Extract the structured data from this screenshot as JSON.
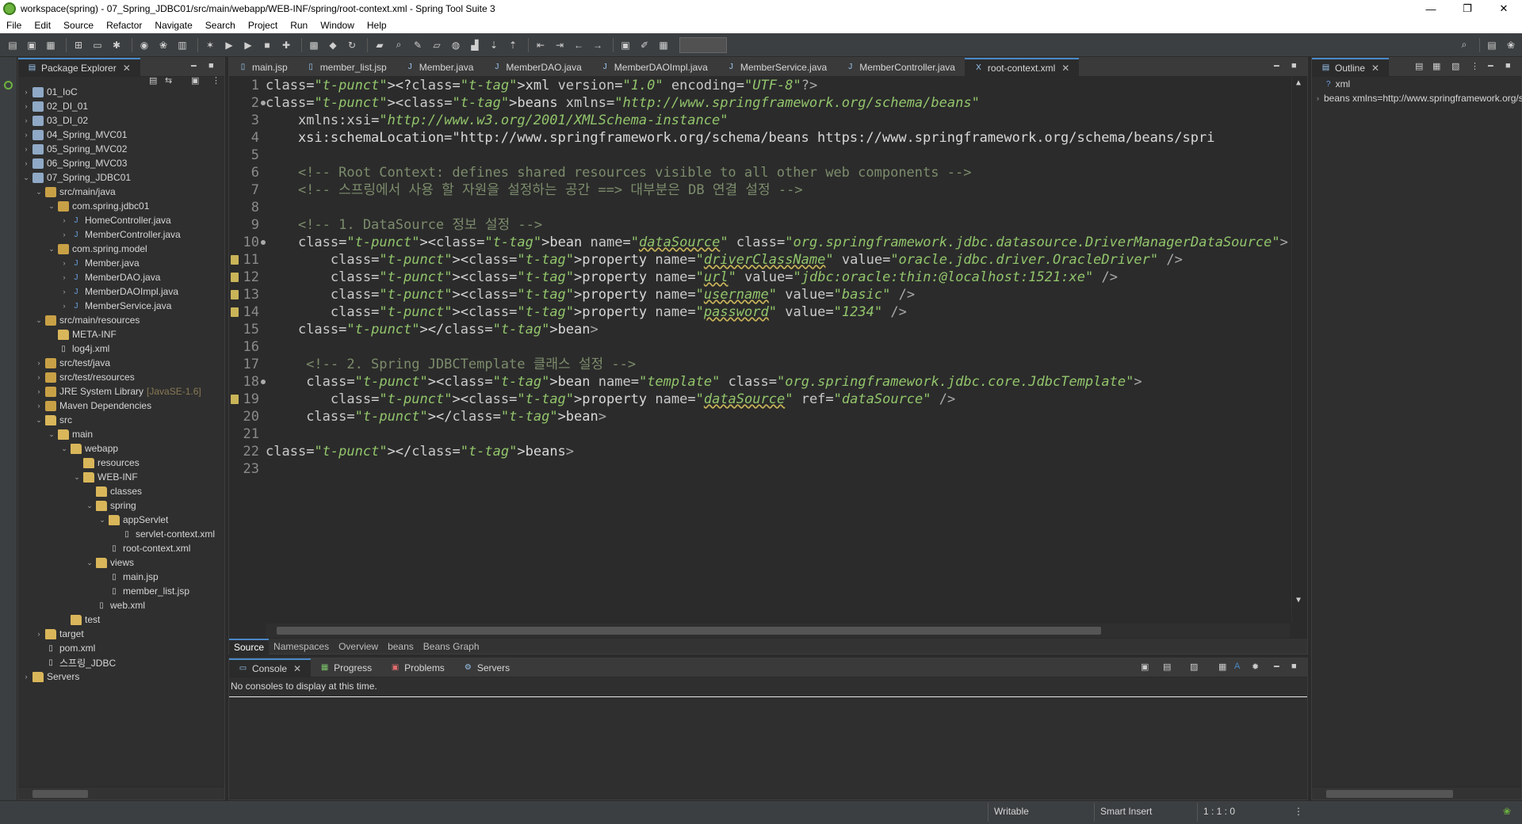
{
  "window": {
    "title": "workspace(spring) - 07_Spring_JDBC01/src/main/webapp/WEB-INF/spring/root-context.xml - Spring Tool Suite 3",
    "controls": [
      "—",
      "❐",
      "✕"
    ]
  },
  "menu": [
    "File",
    "Edit",
    "Source",
    "Refactor",
    "Navigate",
    "Search",
    "Project",
    "Run",
    "Window",
    "Help"
  ],
  "package_explorer": {
    "title": "Package Explorer",
    "tree": [
      {
        "label": "01_IoC",
        "type": "proj",
        "arrow": "›"
      },
      {
        "label": "02_DI_01",
        "type": "proj",
        "arrow": "›"
      },
      {
        "label": "03_DI_02",
        "type": "proj",
        "arrow": "›"
      },
      {
        "label": "04_Spring_MVC01",
        "type": "proj",
        "arrow": "›"
      },
      {
        "label": "05_Spring_MVC02",
        "type": "proj",
        "arrow": "›"
      },
      {
        "label": "06_Spring_MVC03",
        "type": "proj",
        "arrow": "›"
      },
      {
        "label": "07_Spring_JDBC01",
        "type": "proj",
        "arrow": "⌄"
      },
      {
        "label": "src/main/java",
        "type": "pkg",
        "arrow": "⌄"
      },
      {
        "label": "com.spring.jdbc01",
        "type": "pkg",
        "arrow": "⌄"
      },
      {
        "label": "HomeController.java",
        "type": "java",
        "arrow": "›"
      },
      {
        "label": "MemberController.java",
        "type": "java",
        "arrow": "›"
      },
      {
        "label": "com.spring.model",
        "type": "pkg",
        "arrow": "⌄"
      },
      {
        "label": "Member.java",
        "type": "java",
        "arrow": "›"
      },
      {
        "label": "MemberDAO.java",
        "type": "java",
        "arrow": "›"
      },
      {
        "label": "MemberDAOImpl.java",
        "type": "java",
        "arrow": "›"
      },
      {
        "label": "MemberService.java",
        "type": "java",
        "arrow": "›"
      },
      {
        "label": "src/main/resources",
        "type": "pkg",
        "arrow": "⌄"
      },
      {
        "label": "META-INF",
        "type": "folder",
        "arrow": ""
      },
      {
        "label": "log4j.xml",
        "type": "file",
        "arrow": ""
      },
      {
        "label": "src/test/java",
        "type": "pkg",
        "arrow": "›"
      },
      {
        "label": "src/test/resources",
        "type": "pkg",
        "arrow": "›"
      },
      {
        "label": "JRE System Library",
        "extra": "[JavaSE-1.6]",
        "type": "pkg",
        "arrow": "›"
      },
      {
        "label": "Maven Dependencies",
        "type": "pkg",
        "arrow": "›"
      },
      {
        "label": "src",
        "type": "folder",
        "arrow": "⌄"
      },
      {
        "label": "main",
        "type": "folder",
        "arrow": "⌄"
      },
      {
        "label": "webapp",
        "type": "folder",
        "arrow": "⌄"
      },
      {
        "label": "resources",
        "type": "folder",
        "arrow": ""
      },
      {
        "label": "WEB-INF",
        "type": "folder",
        "arrow": "⌄"
      },
      {
        "label": "classes",
        "type": "folder",
        "arrow": ""
      },
      {
        "label": "spring",
        "type": "folder",
        "arrow": "⌄"
      },
      {
        "label": "appServlet",
        "type": "folder",
        "arrow": "⌄"
      },
      {
        "label": "servlet-context.xml",
        "type": "file",
        "arrow": ""
      },
      {
        "label": "root-context.xml",
        "type": "file",
        "arrow": ""
      },
      {
        "label": "views",
        "type": "folder",
        "arrow": "⌄"
      },
      {
        "label": "main.jsp",
        "type": "file",
        "arrow": ""
      },
      {
        "label": "member_list.jsp",
        "type": "file",
        "arrow": ""
      },
      {
        "label": "web.xml",
        "type": "file",
        "arrow": ""
      },
      {
        "label": "test",
        "type": "folder",
        "arrow": ""
      },
      {
        "label": "target",
        "type": "folder",
        "arrow": "›"
      },
      {
        "label": "pom.xml",
        "type": "file",
        "arrow": ""
      },
      {
        "label": "스프링_JDBC",
        "type": "file",
        "arrow": ""
      },
      {
        "label": "Servers",
        "type": "folder",
        "arrow": "›"
      }
    ]
  },
  "editor": {
    "tabs": [
      "main.jsp",
      "member_list.jsp",
      "Member.java",
      "MemberDAO.java",
      "MemberDAOImpl.java",
      "MemberService.java",
      "MemberController.java",
      "root-context.xml"
    ],
    "active_tab": "root-context.xml",
    "line_numbers": [
      "1",
      "2",
      "3",
      "4",
      "5",
      "6",
      "7",
      "8",
      "9",
      "10",
      "11",
      "12",
      "13",
      "14",
      "15",
      "16",
      "17",
      "18",
      "19",
      "20",
      "21",
      "22",
      "23"
    ],
    "lines": [
      "<?xml version=\"1.0\" encoding=\"UTF-8\"?>",
      "<beans xmlns=\"http://www.springframework.org/schema/beans\"",
      "    xmlns:xsi=\"http://www.w3.org/2001/XMLSchema-instance\"",
      "    xsi:schemaLocation=\"http://www.springframework.org/schema/beans https://www.springframework.org/schema/beans/spri",
      "",
      "    <!-- Root Context: defines shared resources visible to all other web components -->",
      "    <!-- 스프링에서 사용 할 자원을 설정하는 공간 ==> 대부분은 DB 연결 설정 -->",
      "",
      "    <!-- 1. DataSource 정보 설정 -->",
      "    <bean name=\"dataSource\" class=\"org.springframework.jdbc.datasource.DriverManagerDataSource\">",
      "        <property name=\"driverClassName\" value=\"oracle.jdbc.driver.OracleDriver\" />",
      "        <property name=\"url\" value=\"jdbc:oracle:thin:@localhost:1521:xe\" />",
      "        <property name=\"username\" value=\"basic\" />",
      "        <property name=\"password\" value=\"1234\" />",
      "    </bean>",
      "",
      "     <!-- 2. Spring JDBCTemplate 클래스 설정 -->",
      "     <bean name=\"template\" class=\"org.springframework.jdbc.core.JdbcTemplate\">",
      "        <property name=\"dataSource\" ref=\"dataSource\" />",
      "     </bean>",
      "",
      "</beans>",
      ""
    ],
    "bottom_tabs": [
      "Source",
      "Namespaces",
      "Overview",
      "beans",
      "Beans Graph"
    ]
  },
  "console": {
    "tabs": [
      "Console",
      "Progress",
      "Problems",
      "Servers"
    ],
    "message": "No consoles to display at this time."
  },
  "outline": {
    "title": "Outline",
    "items": [
      "xml",
      "beans xmlns=http://www.springframework.org/schema/beans"
    ]
  },
  "status": {
    "writable": "Writable",
    "insert_mode": "Smart Insert",
    "position": "1 : 1 : 0"
  },
  "colors": {
    "accent": "#4a88c7",
    "tag": "#6fa8dc",
    "value": "#92c56b",
    "comment": "#7c8c6c"
  }
}
